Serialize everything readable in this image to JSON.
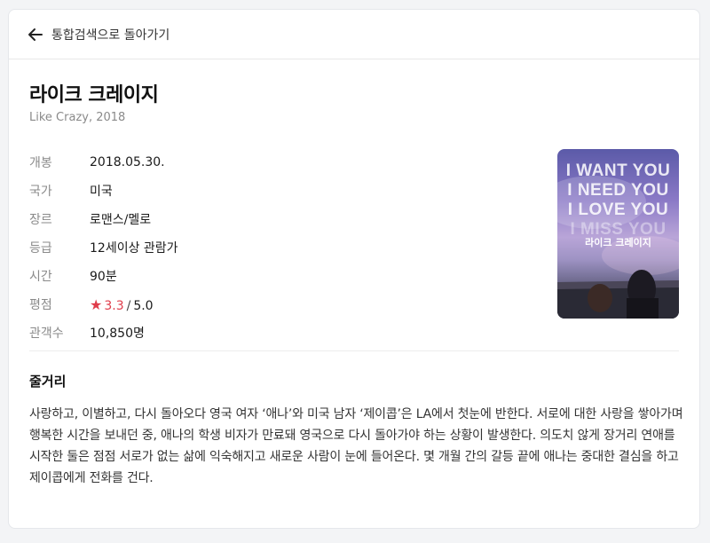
{
  "nav": {
    "back_label": "통합검색으로 돌아가기"
  },
  "movie": {
    "title": "라이크 크레이지",
    "subtitle": "Like Crazy, 2018",
    "info": [
      {
        "key": "개봉",
        "value": "2018.05.30."
      },
      {
        "key": "국가",
        "value": "미국"
      },
      {
        "key": "장르",
        "value": "로맨스/멜로"
      },
      {
        "key": "등급",
        "value": "12세이상 관람가"
      },
      {
        "key": "시간",
        "value": "90분"
      },
      {
        "key": "평점",
        "value": "3.3",
        "max": "5.0"
      },
      {
        "key": "관객수",
        "value": "10,850명"
      }
    ],
    "poster": {
      "lines": [
        "I WANT YOU",
        "I NEED YOU",
        "I LOVE YOU",
        "I MISS YOU"
      ],
      "title": "라이크 크레이지"
    }
  },
  "synopsis": {
    "heading": "줄거리",
    "text": "사랑하고, 이별하고, 다시 돌아오다 영국 여자 ‘애나’와 미국 남자 ‘제이콥’은 LA에서 첫눈에 반한다. 서로에 대한 사랑을 쌓아가며 행복한 시간을 보내던 중, 애나의 학생 비자가 만료돼 영국으로 다시 돌아가야 하는 상황이 발생한다. 의도치 않게 장거리 연애를 시작한 둘은 점점 서로가 없는 삶에 익숙해지고 새로운 사람이 눈에 들어온다. 몇 개월 간의 갈등 끝에 애나는 중대한 결심을 하고 제이콥에게 전화를 건다."
  },
  "colors": {
    "accent_red": "#e03c4a",
    "muted": "#8a8a8a"
  }
}
